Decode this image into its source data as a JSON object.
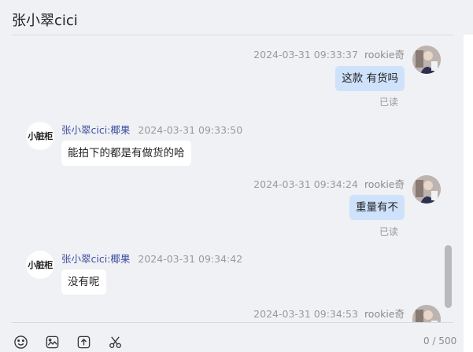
{
  "header": {
    "title": "张小翠cici"
  },
  "messages": [
    {
      "direction": "out",
      "time": "2024-03-31 09:33:37",
      "sender": "rookie奇",
      "text": "这款 有货吗",
      "status": "已读"
    },
    {
      "direction": "in",
      "sender": "张小翠cici:椰果",
      "time": "2024-03-31 09:33:50",
      "text": "能拍下的都是有做货的哈",
      "avatar_text": "小脏柜"
    },
    {
      "direction": "out",
      "time": "2024-03-31 09:34:24",
      "sender": "rookie奇",
      "text": "重量有不",
      "status": "已读"
    },
    {
      "direction": "in",
      "sender": "张小翠cici:椰果",
      "time": "2024-03-31 09:34:42",
      "text": "没有呢",
      "avatar_text": "小脏柜"
    },
    {
      "direction": "out",
      "time": "2024-03-31 09:34:53",
      "sender": "rookie奇"
    }
  ],
  "toolbar": {
    "icons": [
      "emoji-icon",
      "image-icon",
      "upload-icon",
      "scissors-icon"
    ],
    "char_counter": "0 / 500"
  },
  "colors": {
    "background": "#f0f1f5",
    "outgoing_bubble": "#cfe2fb",
    "incoming_bubble": "#ffffff",
    "sender_name": "#3d4f9f"
  }
}
